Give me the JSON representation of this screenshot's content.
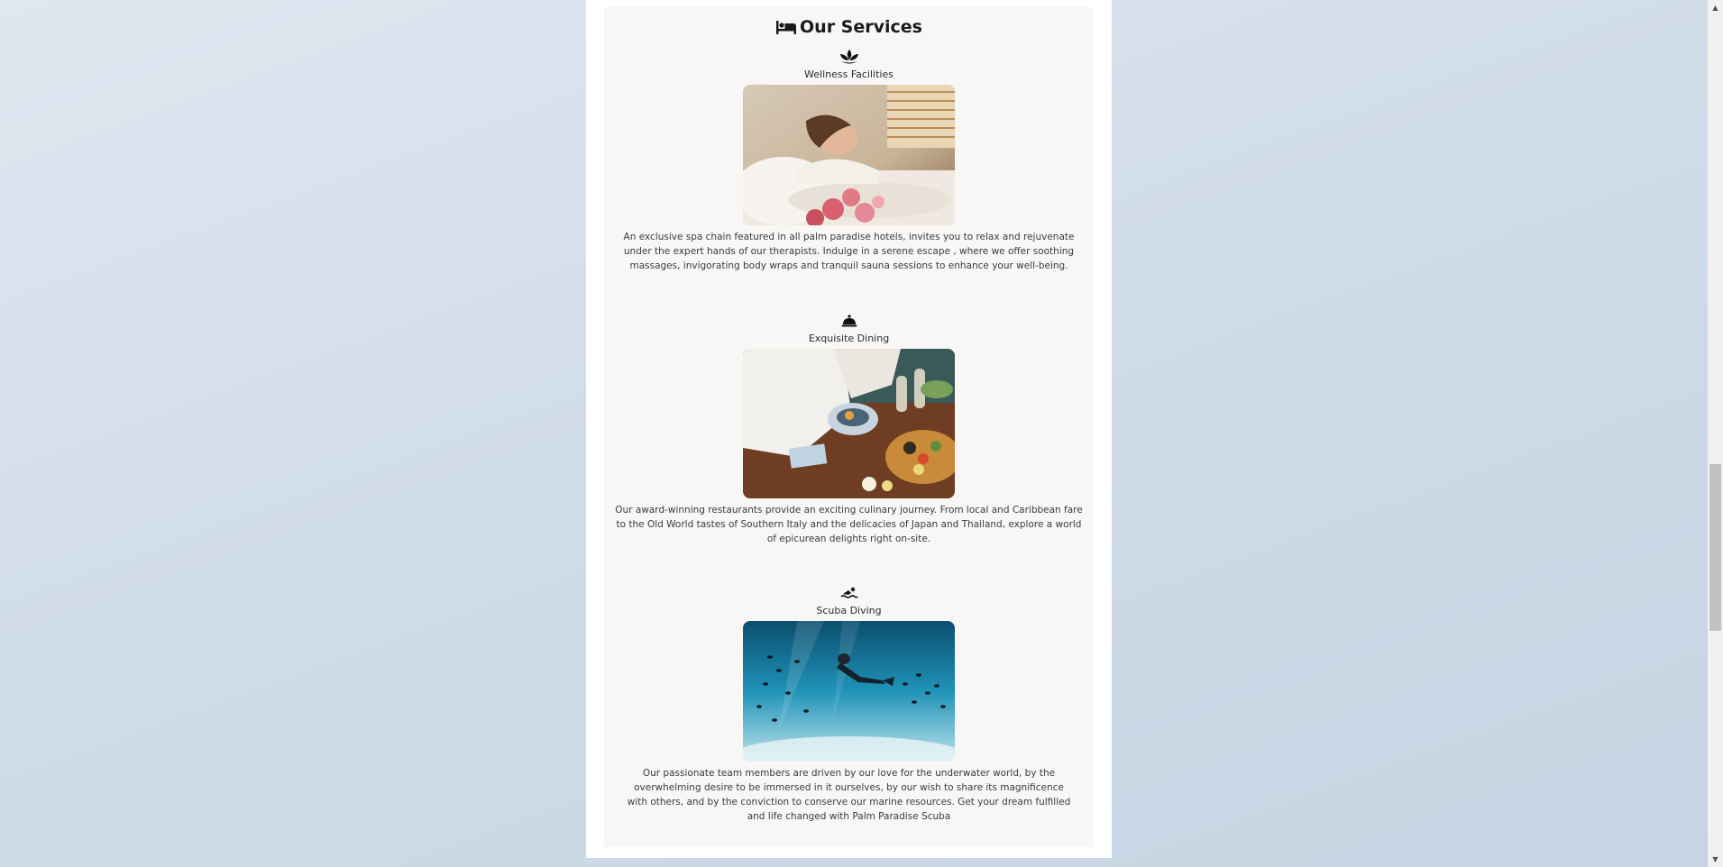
{
  "services": {
    "heading": "Our Services",
    "heading_icon": "bed-icon",
    "items": [
      {
        "icon": "lotus-icon",
        "title": "Wellness Facilities",
        "image": "spa-massage-photo",
        "description": "An exclusive spa chain featured in all palm paradise hotels, invites you to relax and rejuvenate under the expert hands of our therapists. Indulge in a serene escape , where we offer soothing massages, invigorating body wraps and tranquil sauna sessions to enhance your well-being."
      },
      {
        "icon": "concierge-bell-icon",
        "title": "Exquisite Dining",
        "image": "dining-table-photo",
        "description": "Our award-winning restaurants provide an exciting culinary journey. From local and Caribbean fare to the Old World tastes of Southern Italy and the delicacies of Japan and Thailand, explore a world of epicurean delights right on-site."
      },
      {
        "icon": "swimmer-icon",
        "title": "Scuba Diving",
        "image": "underwater-diver-photo",
        "description": "Our passionate team members are driven by our love for the underwater world, by the overwhelming desire to be immersed in it ourselves, by our wish to share its magnificence with others, and by the conviction to conserve our marine resources. Get your dream fulfilled and life changed with Palm Paradise Scuba"
      }
    ]
  },
  "scrollbar": {
    "position_fraction": 0.54
  }
}
